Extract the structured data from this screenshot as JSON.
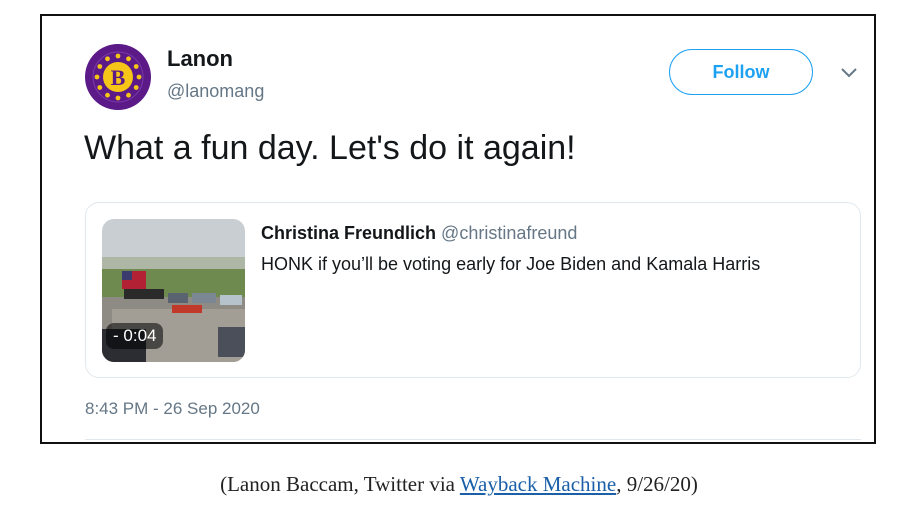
{
  "tweet": {
    "author_name": "Lanon",
    "author_handle": "@lanomang",
    "avatar_letter": "B",
    "follow_label": "Follow",
    "text": "What a fun day. Let's do it again!",
    "timestamp": "8:43 PM - 26 Sep 2020",
    "quoted": {
      "author_name": "Christina Freundlich",
      "author_handle": "@christinafreund",
      "text": "HONK if you’ll be voting early for Joe Biden and Kamala Harris",
      "video_duration": "0:04"
    }
  },
  "caption": {
    "prefix": "(Lanon Baccam, Twitter via ",
    "link_text": "Wayback Machine",
    "suffix": ", 9/26/20)"
  },
  "colors": {
    "accent": "#1da1f2",
    "avatar_purple": "#5b1a87",
    "avatar_gold": "#f5c518"
  }
}
